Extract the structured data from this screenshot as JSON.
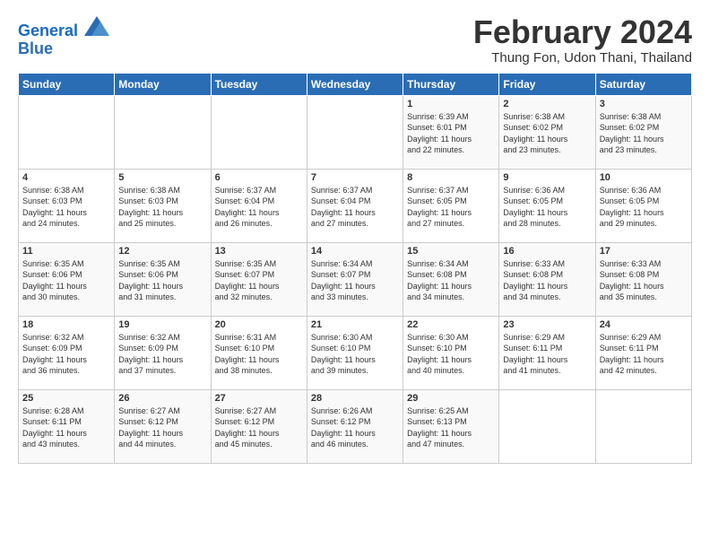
{
  "logo": {
    "line1": "General",
    "line2": "Blue"
  },
  "title": "February 2024",
  "location": "Thung Fon, Udon Thani, Thailand",
  "days_of_week": [
    "Sunday",
    "Monday",
    "Tuesday",
    "Wednesday",
    "Thursday",
    "Friday",
    "Saturday"
  ],
  "weeks": [
    [
      {
        "day": "",
        "info": ""
      },
      {
        "day": "",
        "info": ""
      },
      {
        "day": "",
        "info": ""
      },
      {
        "day": "",
        "info": ""
      },
      {
        "day": "1",
        "info": "Sunrise: 6:39 AM\nSunset: 6:01 PM\nDaylight: 11 hours\nand 22 minutes."
      },
      {
        "day": "2",
        "info": "Sunrise: 6:38 AM\nSunset: 6:02 PM\nDaylight: 11 hours\nand 23 minutes."
      },
      {
        "day": "3",
        "info": "Sunrise: 6:38 AM\nSunset: 6:02 PM\nDaylight: 11 hours\nand 23 minutes."
      }
    ],
    [
      {
        "day": "4",
        "info": "Sunrise: 6:38 AM\nSunset: 6:03 PM\nDaylight: 11 hours\nand 24 minutes."
      },
      {
        "day": "5",
        "info": "Sunrise: 6:38 AM\nSunset: 6:03 PM\nDaylight: 11 hours\nand 25 minutes."
      },
      {
        "day": "6",
        "info": "Sunrise: 6:37 AM\nSunset: 6:04 PM\nDaylight: 11 hours\nand 26 minutes."
      },
      {
        "day": "7",
        "info": "Sunrise: 6:37 AM\nSunset: 6:04 PM\nDaylight: 11 hours\nand 27 minutes."
      },
      {
        "day": "8",
        "info": "Sunrise: 6:37 AM\nSunset: 6:05 PM\nDaylight: 11 hours\nand 27 minutes."
      },
      {
        "day": "9",
        "info": "Sunrise: 6:36 AM\nSunset: 6:05 PM\nDaylight: 11 hours\nand 28 minutes."
      },
      {
        "day": "10",
        "info": "Sunrise: 6:36 AM\nSunset: 6:05 PM\nDaylight: 11 hours\nand 29 minutes."
      }
    ],
    [
      {
        "day": "11",
        "info": "Sunrise: 6:35 AM\nSunset: 6:06 PM\nDaylight: 11 hours\nand 30 minutes."
      },
      {
        "day": "12",
        "info": "Sunrise: 6:35 AM\nSunset: 6:06 PM\nDaylight: 11 hours\nand 31 minutes."
      },
      {
        "day": "13",
        "info": "Sunrise: 6:35 AM\nSunset: 6:07 PM\nDaylight: 11 hours\nand 32 minutes."
      },
      {
        "day": "14",
        "info": "Sunrise: 6:34 AM\nSunset: 6:07 PM\nDaylight: 11 hours\nand 33 minutes."
      },
      {
        "day": "15",
        "info": "Sunrise: 6:34 AM\nSunset: 6:08 PM\nDaylight: 11 hours\nand 34 minutes."
      },
      {
        "day": "16",
        "info": "Sunrise: 6:33 AM\nSunset: 6:08 PM\nDaylight: 11 hours\nand 34 minutes."
      },
      {
        "day": "17",
        "info": "Sunrise: 6:33 AM\nSunset: 6:08 PM\nDaylight: 11 hours\nand 35 minutes."
      }
    ],
    [
      {
        "day": "18",
        "info": "Sunrise: 6:32 AM\nSunset: 6:09 PM\nDaylight: 11 hours\nand 36 minutes."
      },
      {
        "day": "19",
        "info": "Sunrise: 6:32 AM\nSunset: 6:09 PM\nDaylight: 11 hours\nand 37 minutes."
      },
      {
        "day": "20",
        "info": "Sunrise: 6:31 AM\nSunset: 6:10 PM\nDaylight: 11 hours\nand 38 minutes."
      },
      {
        "day": "21",
        "info": "Sunrise: 6:30 AM\nSunset: 6:10 PM\nDaylight: 11 hours\nand 39 minutes."
      },
      {
        "day": "22",
        "info": "Sunrise: 6:30 AM\nSunset: 6:10 PM\nDaylight: 11 hours\nand 40 minutes."
      },
      {
        "day": "23",
        "info": "Sunrise: 6:29 AM\nSunset: 6:11 PM\nDaylight: 11 hours\nand 41 minutes."
      },
      {
        "day": "24",
        "info": "Sunrise: 6:29 AM\nSunset: 6:11 PM\nDaylight: 11 hours\nand 42 minutes."
      }
    ],
    [
      {
        "day": "25",
        "info": "Sunrise: 6:28 AM\nSunset: 6:11 PM\nDaylight: 11 hours\nand 43 minutes."
      },
      {
        "day": "26",
        "info": "Sunrise: 6:27 AM\nSunset: 6:12 PM\nDaylight: 11 hours\nand 44 minutes."
      },
      {
        "day": "27",
        "info": "Sunrise: 6:27 AM\nSunset: 6:12 PM\nDaylight: 11 hours\nand 45 minutes."
      },
      {
        "day": "28",
        "info": "Sunrise: 6:26 AM\nSunset: 6:12 PM\nDaylight: 11 hours\nand 46 minutes."
      },
      {
        "day": "29",
        "info": "Sunrise: 6:25 AM\nSunset: 6:13 PM\nDaylight: 11 hours\nand 47 minutes."
      },
      {
        "day": "",
        "info": ""
      },
      {
        "day": "",
        "info": ""
      }
    ]
  ]
}
